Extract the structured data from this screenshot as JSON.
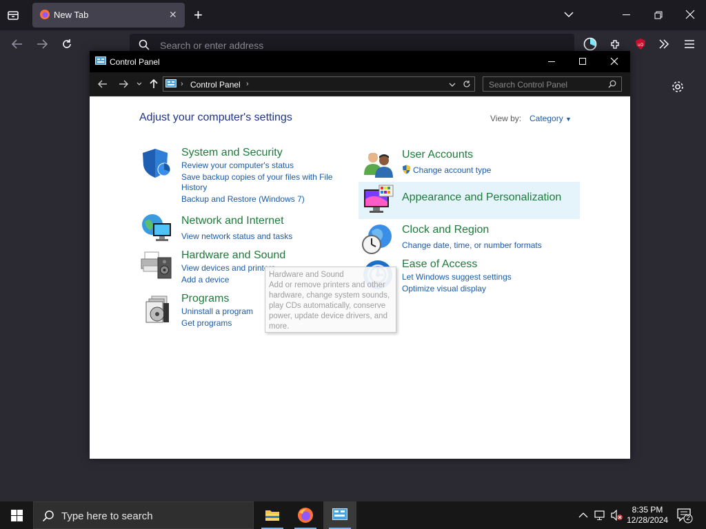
{
  "browser": {
    "tab_title": "New Tab",
    "url_placeholder": "Search or enter address"
  },
  "window": {
    "title": "Control Panel",
    "breadcrumb": "Control Panel",
    "search_placeholder": "Search Control Panel"
  },
  "page": {
    "heading": "Adjust your computer's settings",
    "view_by_label": "View by:",
    "view_by_value": "Category"
  },
  "categories_left": [
    {
      "title": "System and Security",
      "icon": "shield-icon",
      "links": [
        "Review your computer's status",
        "Save backup copies of your files with File",
        "History",
        "Backup and Restore (Windows 7)"
      ]
    },
    {
      "title": "Network and Internet",
      "icon": "network-globe-icon",
      "links": [
        "View network status and tasks"
      ]
    },
    {
      "title": "Hardware and Sound",
      "icon": "printer-speaker-icon",
      "links": [
        "View devices and printers",
        "Add a device"
      ]
    },
    {
      "title": "Programs",
      "icon": "programs-disc-icon",
      "links": [
        "Uninstall a program",
        "Get programs"
      ]
    }
  ],
  "categories_right": [
    {
      "title": "User Accounts",
      "icon": "users-icon",
      "links": [
        "Change account type"
      ]
    },
    {
      "title": "Appearance and Personalization",
      "icon": "monitor-palette-icon",
      "links": []
    },
    {
      "title": "Clock and Region",
      "icon": "clock-globe-icon",
      "links": [
        "Change date, time, or number formats"
      ]
    },
    {
      "title": "Ease of Access",
      "icon": "ease-of-access-icon",
      "links": [
        "Let Windows suggest settings",
        "Optimize visual display"
      ]
    }
  ],
  "tooltip": {
    "title": "Hardware and Sound",
    "body": "Add or remove printers and other hardware, change system sounds, play CDs automatically, conserve power, update device drivers, and more."
  },
  "taskbar": {
    "search_placeholder": "Type here to search",
    "time": "8:35 PM",
    "date": "12/28/2024",
    "notification_count": "2"
  }
}
